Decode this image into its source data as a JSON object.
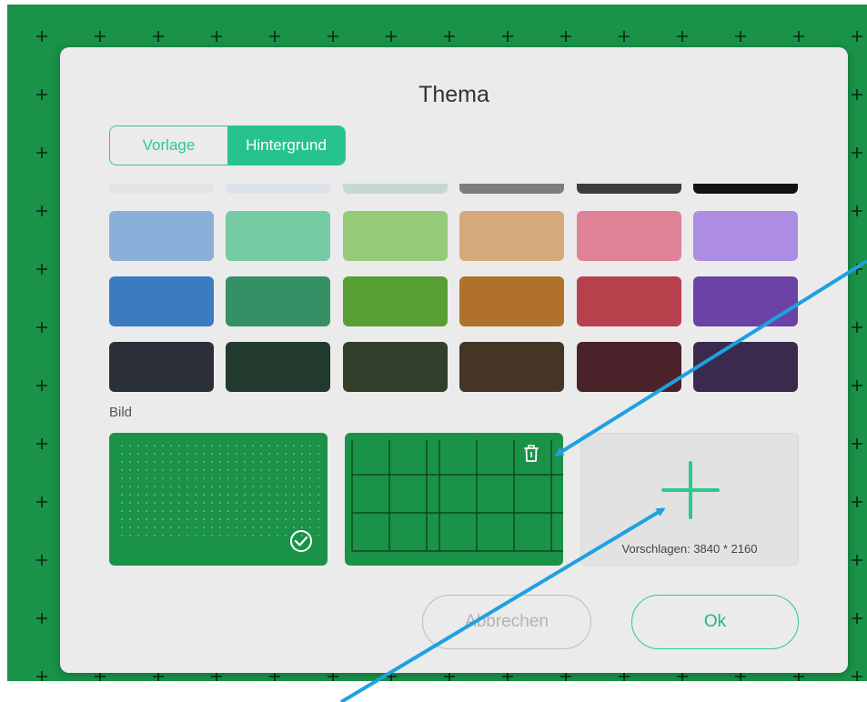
{
  "dialog": {
    "title": "Thema",
    "tabs": [
      {
        "label": "Vorlage",
        "active": false
      },
      {
        "label": "Hintergrund",
        "active": true
      }
    ],
    "swatch_rows": [
      [
        "#e4e4e4",
        "#dde3e8",
        "#c6d8d1",
        "#7d7d80",
        "#3d3d3d",
        "#121212"
      ],
      [
        "#8ab0da",
        "#74cba4",
        "#95cb78",
        "#d4a97b",
        "#df8298",
        "#ad8ce3"
      ],
      [
        "#3b7cc0",
        "#359066",
        "#579f33",
        "#b0712c",
        "#b7404d",
        "#6b42a6"
      ],
      [
        "#2b2f39",
        "#213a2d",
        "#323f2b",
        "#453527",
        "#4b212a",
        "#3a2a4d"
      ]
    ],
    "image_section_label": "Bild",
    "image_cards": [
      {
        "name": "dot-grid",
        "bg": "#1a9248",
        "selected": true
      },
      {
        "name": "line-grid",
        "bg": "#1a9248",
        "deletable": true
      }
    ],
    "add_hint": "Vorschlagen: 3840 * 2160",
    "cancel_label": "Abbrechen",
    "ok_label": "Ok"
  },
  "colors": {
    "board": "#1a9248",
    "accent": "#2ec98d",
    "annotation_arrow": "#1ea1e0"
  }
}
